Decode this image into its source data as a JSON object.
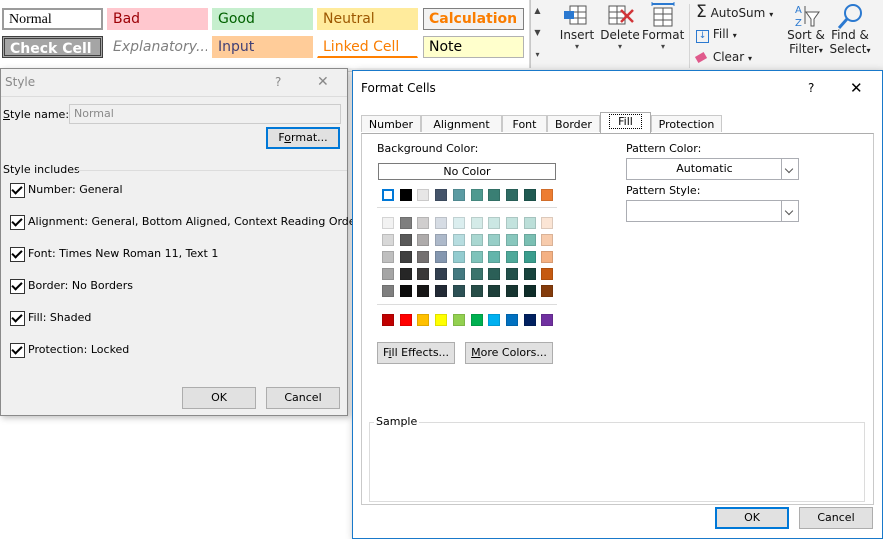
{
  "ribbon": {
    "cell_styles": [
      {
        "label": "Normal",
        "bg": "#ffffff",
        "fg": "#000000",
        "border": "#9b9b9b"
      },
      {
        "label": "Bad",
        "bg": "#ffc7ce",
        "fg": "#9c0006",
        "border": "#ffc7ce"
      },
      {
        "label": "Good",
        "bg": "#c6efce",
        "fg": "#006100",
        "border": "#c6efce"
      },
      {
        "label": "Neutral",
        "bg": "#ffeb9c",
        "fg": "#9c5700",
        "border": "#ffeb9c"
      },
      {
        "label": "Calculation",
        "bg": "#f2f2f2",
        "fg": "#fa7d00",
        "border": "#7f7f7f"
      },
      {
        "label": "Check Cell",
        "bg": "#a5a5a5",
        "fg": "#ffffff",
        "border": "#3f3f3f"
      },
      {
        "label": "Explanatory...",
        "bg": "#ffffff",
        "fg": "#7f7f7f",
        "border": "#ffffff"
      },
      {
        "label": "Input",
        "bg": "#ffcc99",
        "fg": "#3f3f76",
        "border": "#ffcc99"
      },
      {
        "label": "Linked Cell",
        "bg": "#ffffff",
        "fg": "#fa7d00",
        "border": "#ffffff"
      },
      {
        "label": "Note",
        "bg": "#ffffcc",
        "fg": "#000000",
        "border": "#b2b2b2"
      }
    ],
    "cells_group": {
      "insert": "Insert",
      "delete": "Delete",
      "format": "Format"
    },
    "editing_group": {
      "autosum": "AutoSum",
      "fill": "Fill",
      "clear": "Clear",
      "sort": "Sort &",
      "filter": "Filter",
      "find": "Find &",
      "select": "Select"
    }
  },
  "style_dialog": {
    "title": "Style",
    "help": "?",
    "close": "✕",
    "style_name_label": "Style name:",
    "style_name_value": "Normal",
    "format_button": "Format...",
    "includes_label": "Style includes",
    "items": [
      {
        "label": "Number: General",
        "checked": true
      },
      {
        "label": "Alignment: General, Bottom Aligned, Context Reading Order",
        "checked": true
      },
      {
        "label": "Font: Times New Roman 11, Text 1",
        "checked": true
      },
      {
        "label": "Border: No Borders",
        "checked": true
      },
      {
        "label": "Fill: Shaded",
        "checked": true
      },
      {
        "label": "Protection: Locked",
        "checked": true
      }
    ],
    "ok": "OK",
    "cancel": "Cancel"
  },
  "format_cells": {
    "title": "Format Cells",
    "help": "?",
    "close": "✕",
    "tabs": [
      "Number",
      "Alignment",
      "Font",
      "Border",
      "Fill",
      "Protection"
    ],
    "active_tab": "Fill",
    "background_color_label": "Background Color:",
    "no_color": "No Color",
    "theme_row": [
      "#ffffff",
      "#000000",
      "#e7e6e6",
      "#44546a",
      "#5b9ba3",
      "#4f9a90",
      "#3a7f74",
      "#2e6b63",
      "#1f5a52",
      "#ed7d31"
    ],
    "shade_rows": [
      [
        "#f2f2f2",
        "#7f7f7f",
        "#d0cece",
        "#d6dce4",
        "#dbeeef",
        "#d4ebe8",
        "#cbe7e3",
        "#c3e3de",
        "#bcdfd9",
        "#fbe5d5"
      ],
      [
        "#d8d8d8",
        "#595959",
        "#aeabab",
        "#adb9ca",
        "#b7dde0",
        "#a9d7d1",
        "#97cec7",
        "#88c7bd",
        "#7abfb3",
        "#f7cbac"
      ],
      [
        "#bfbfbf",
        "#3f3f3f",
        "#757171",
        "#8497b0",
        "#93ccd0",
        "#7ec3ba",
        "#63b5ab",
        "#4fa99a",
        "#3a9d8d",
        "#f4b183"
      ],
      [
        "#a5a5a5",
        "#262626",
        "#3a3838",
        "#323f4f",
        "#447980",
        "#3b746c",
        "#2b5f57",
        "#22504a",
        "#17433d",
        "#c55a11"
      ],
      [
        "#7f7f7f",
        "#0c0c0c",
        "#171616",
        "#222a35",
        "#2d5155",
        "#274d48",
        "#1d3f3a",
        "#173531",
        "#0f2d29",
        "#843c0c"
      ]
    ],
    "standard_row": [
      "#c00000",
      "#ff0000",
      "#ffc000",
      "#ffff00",
      "#92d050",
      "#00b050",
      "#00b0f0",
      "#0070c0",
      "#002060",
      "#7030a0"
    ],
    "fill_effects": "Fill Effects...",
    "more_colors": "More Colors...",
    "pattern_color_label": "Pattern Color:",
    "pattern_color_value": "Automatic",
    "pattern_style_label": "Pattern Style:",
    "pattern_style_value": "",
    "sample_label": "Sample",
    "ok": "OK",
    "cancel": "Cancel"
  }
}
